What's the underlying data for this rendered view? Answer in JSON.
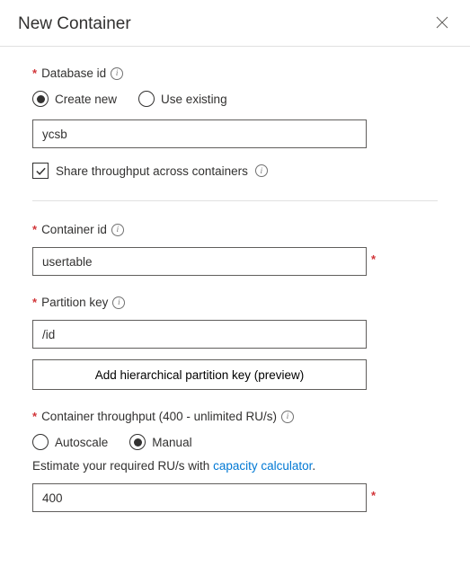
{
  "header": {
    "title": "New Container"
  },
  "database": {
    "label": "Database id",
    "radio_create": "Create new",
    "radio_use": "Use existing",
    "selected": "create",
    "value": "ycsb",
    "share_label": "Share throughput across containers",
    "share_checked": true
  },
  "container": {
    "label": "Container id",
    "value": "usertable"
  },
  "partition": {
    "label": "Partition key",
    "value": "/id",
    "hierarchical_btn": "Add hierarchical partition key (preview)"
  },
  "throughput": {
    "label": "Container throughput (400 - unlimited RU/s)",
    "radio_autoscale": "Autoscale",
    "radio_manual": "Manual",
    "selected": "manual",
    "help_prefix": "Estimate your required RU/s with ",
    "help_link": "capacity calculator",
    "help_suffix": ".",
    "value": "400"
  }
}
